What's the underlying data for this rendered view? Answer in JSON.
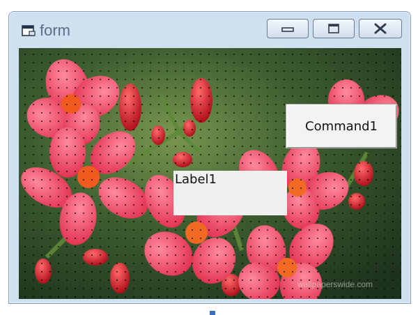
{
  "window": {
    "title": "form",
    "controls": {
      "minimize": "minimize",
      "maximize": "maximize",
      "close": "close"
    }
  },
  "form": {
    "command_button": {
      "label": "Command1"
    },
    "label": {
      "text": "Label1"
    },
    "background_image": {
      "watermark": "wallpaperswide.com"
    }
  }
}
